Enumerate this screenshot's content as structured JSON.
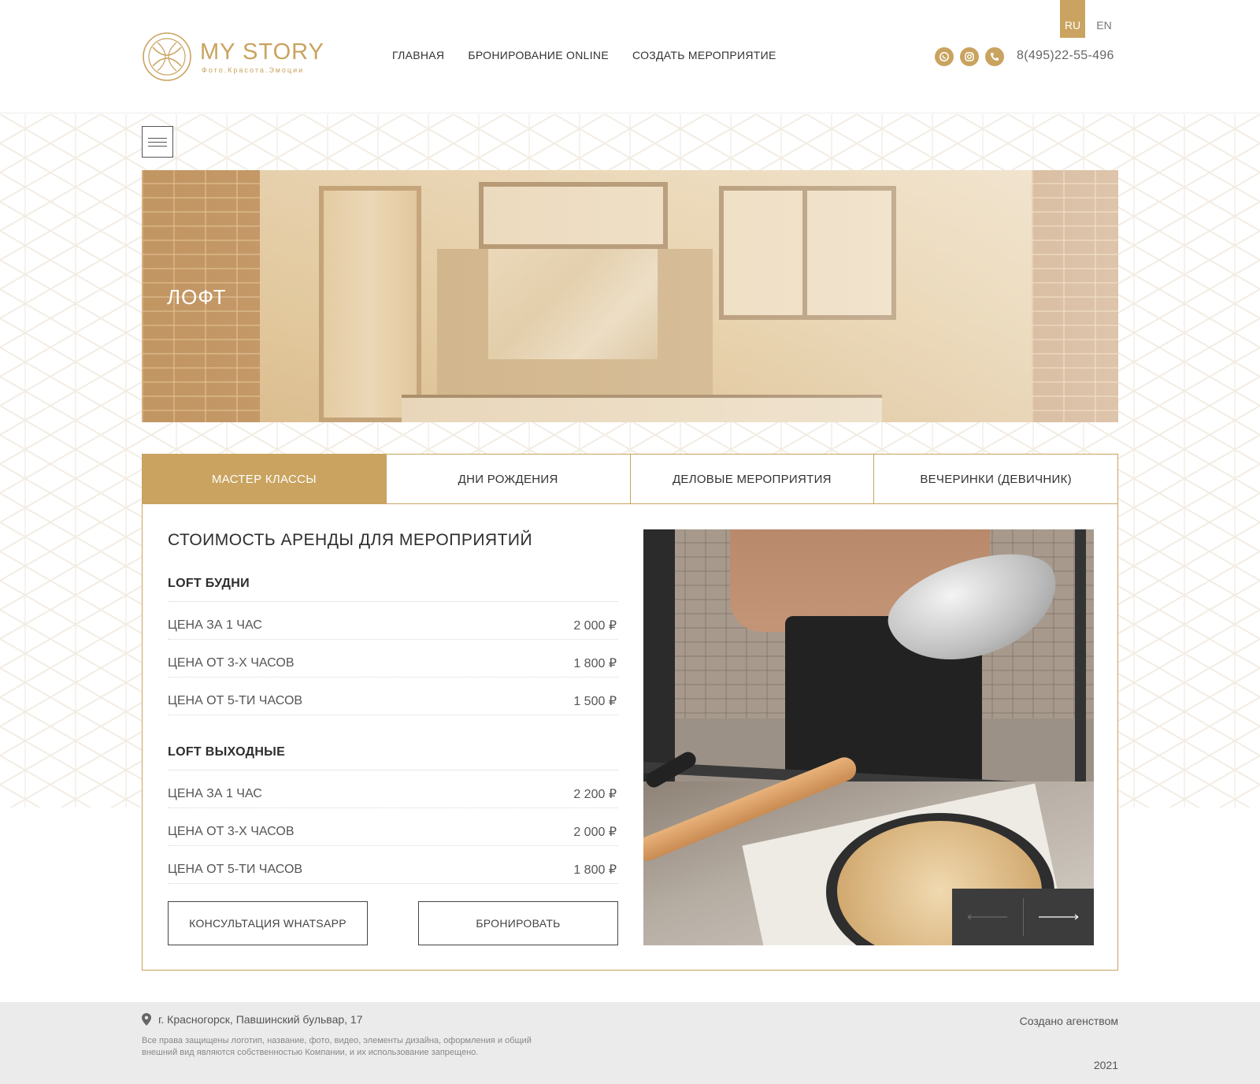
{
  "brand": {
    "name": "MY STORY",
    "tagline": "Фото.Красота.Эмоции",
    "accent_color": "#c9a35f"
  },
  "nav": {
    "items": [
      "ГЛАВНАЯ",
      "БРОНИРОВАНИЕ ONLINE",
      "СОЗДАТЬ МЕРОПРИЯТИЕ"
    ]
  },
  "languages": {
    "active": "RU",
    "other": "EN"
  },
  "contacts": {
    "icons": [
      "whatsapp-icon",
      "instagram-icon",
      "phone-icon"
    ],
    "phone": "8(495)22-55-496"
  },
  "banner": {
    "title": "ЛОФТ"
  },
  "tabs": [
    {
      "label": "МАСТЕР КЛАССЫ",
      "active": true
    },
    {
      "label": "ДНИ РОЖДЕНИЯ",
      "active": false
    },
    {
      "label": "ДЕЛОВЫЕ МЕРОПРИЯТИЯ",
      "active": false
    },
    {
      "label": "ВЕЧЕРИНКИ (ДЕВИЧНИК)",
      "active": false
    }
  ],
  "pricing": {
    "title": "СТОИМОСТЬ АРЕНДЫ ДЛЯ МЕРОПРИЯТИЙ",
    "groups": [
      {
        "title": "LOFT БУДНИ",
        "rows": [
          {
            "label": "ЦЕНА ЗА 1 ЧАС",
            "price": "2 000 ₽"
          },
          {
            "label": "ЦЕНА ОТ 3-Х ЧАСОВ",
            "price": "1 800 ₽"
          },
          {
            "label": "ЦЕНА ОТ 5-ТИ ЧАСОВ",
            "price": "1 500 ₽"
          }
        ]
      },
      {
        "title": "LOFT ВЫХОДНЫЕ",
        "rows": [
          {
            "label": "ЦЕНА ЗА 1 ЧАС",
            "price": "2 200 ₽"
          },
          {
            "label": "ЦЕНА ОТ 3-Х ЧАСОВ",
            "price": "2 000 ₽"
          },
          {
            "label": "ЦЕНА ОТ 5-ТИ ЧАСОВ",
            "price": "1 800 ₽"
          }
        ]
      }
    ],
    "buttons": {
      "whatsapp": "КОНСУЛЬТАЦИЯ WHATSAPP",
      "book": "БРОНИРОВАТЬ"
    }
  },
  "footer": {
    "address": "г. Красногорск, Павшинский бульвар, 17",
    "copyright": "Все права защищены логотип, название, фото, видео, элементы дизайна, оформления и общий внешний вид являются собственностью Компании, и их использование запрещено.",
    "agency": "Создано агенством",
    "year": "2021"
  }
}
